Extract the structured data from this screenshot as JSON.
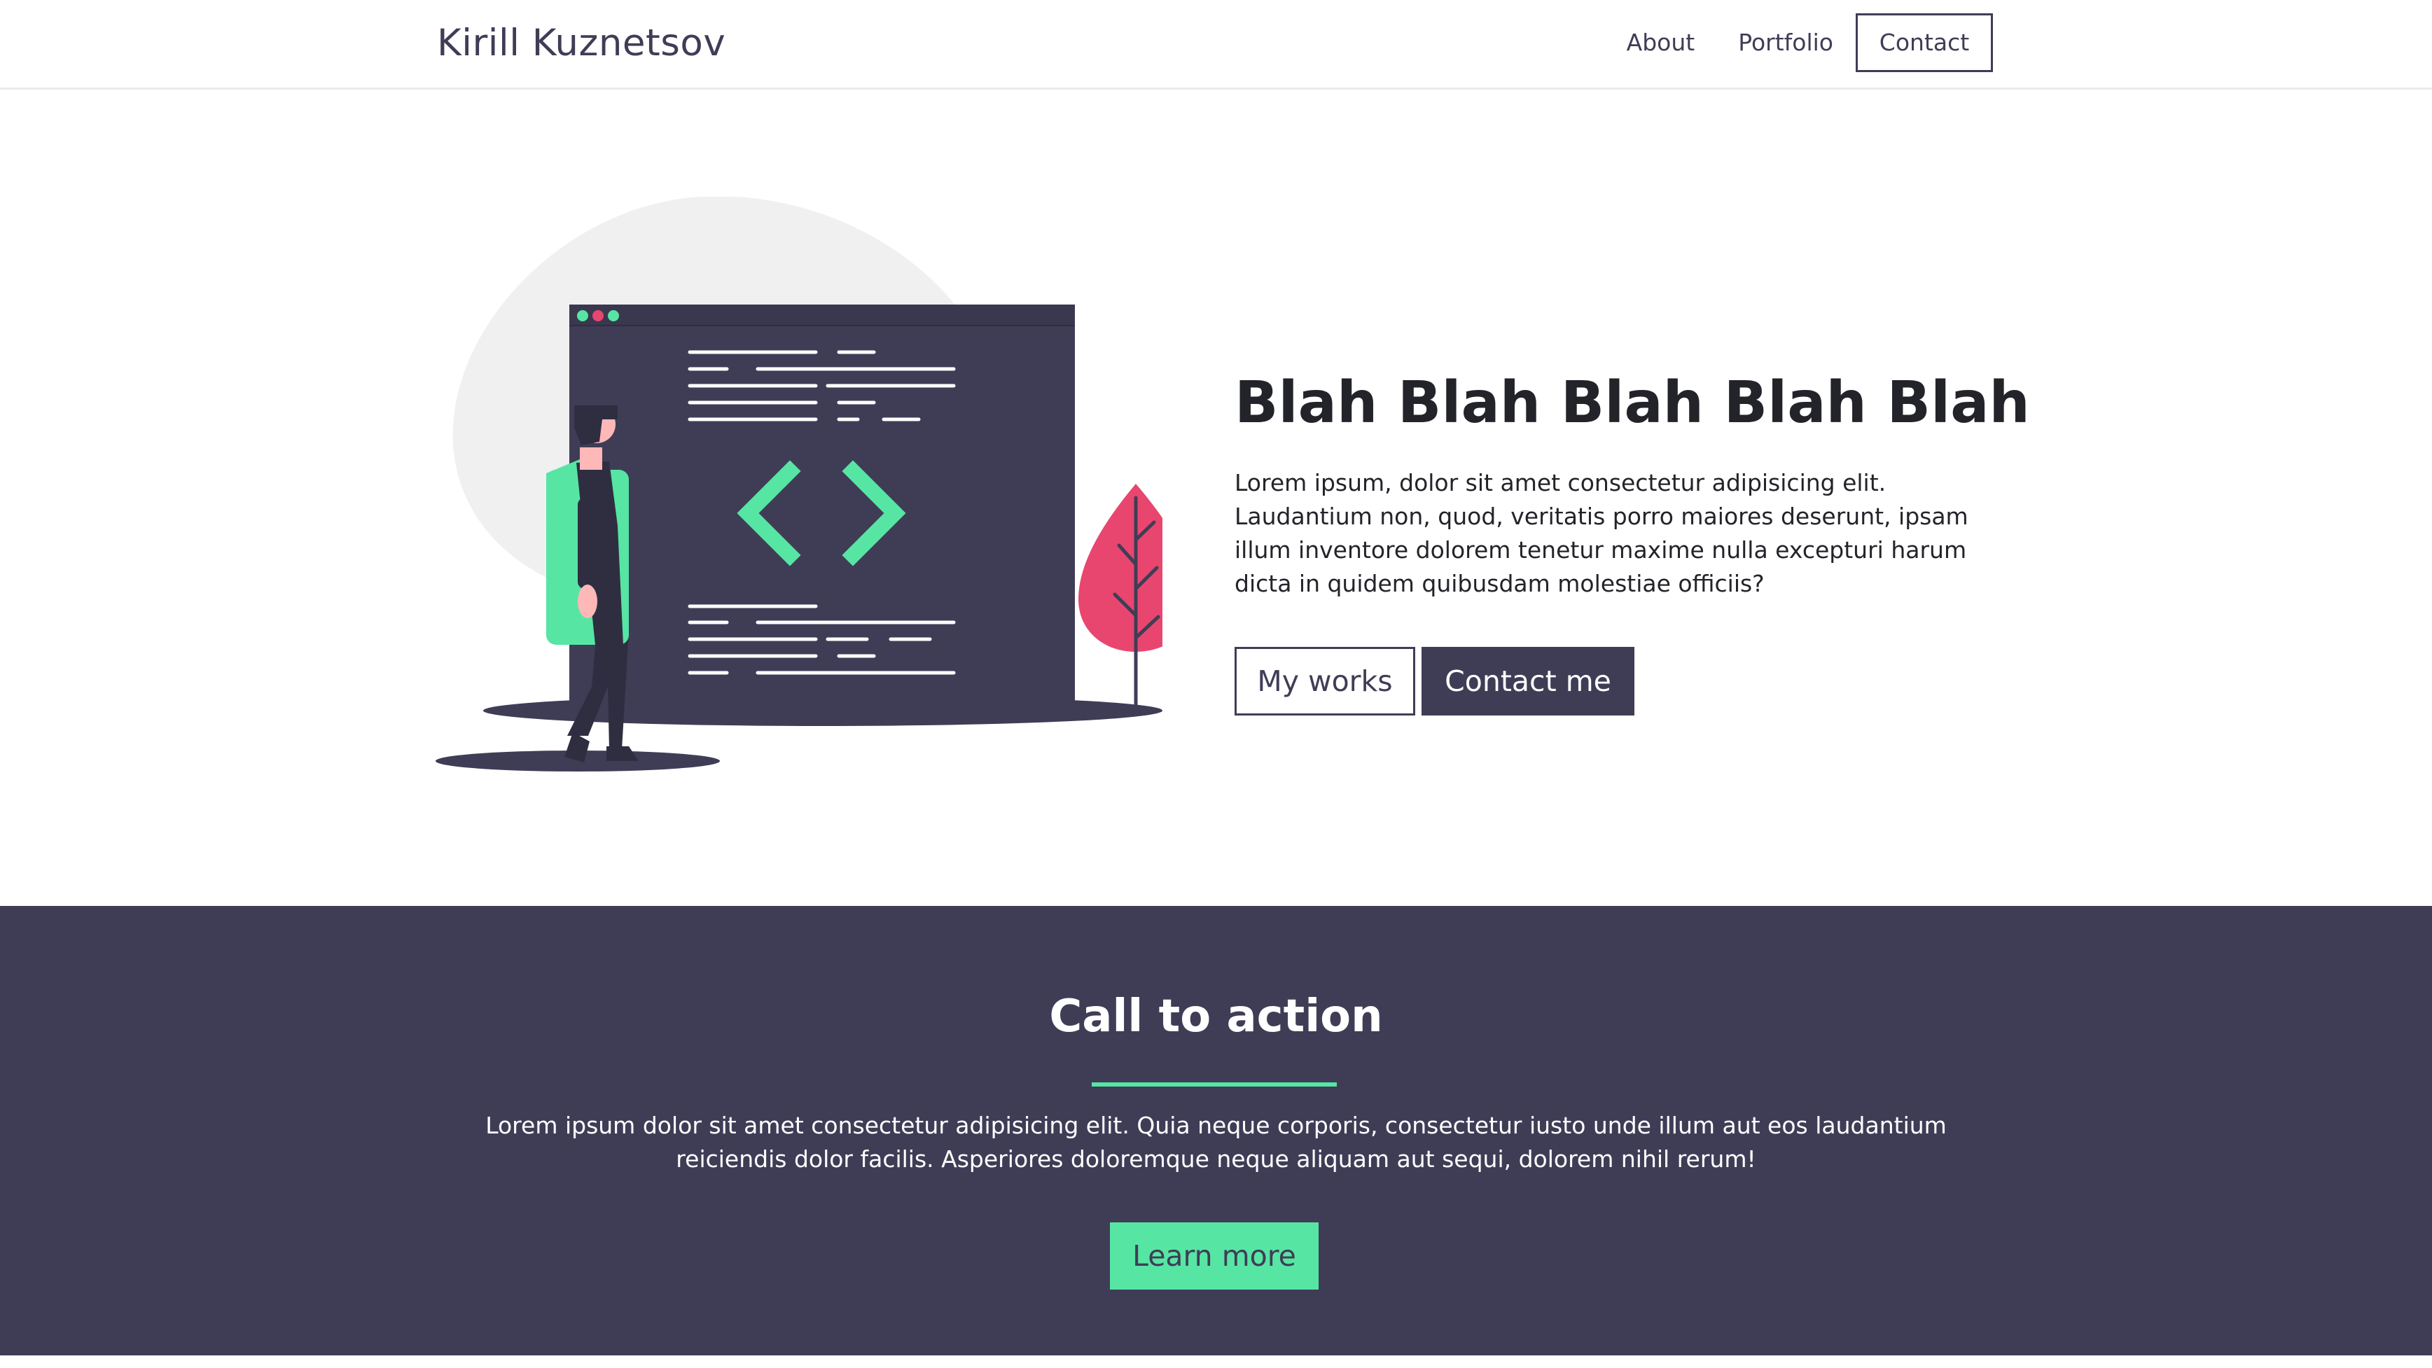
{
  "header": {
    "brand": "Kirill Kuznetsov",
    "nav": {
      "about": "About",
      "portfolio": "Portfolio",
      "contact": "Contact"
    }
  },
  "hero": {
    "title": "Blah Blah Blah Blah Blah",
    "description": "Lorem ipsum, dolor sit amet consectetur adipisicing elit. Laudantium non, quod, veritatis porro maiores deserunt, ipsam illum inventore dolorem tenetur maxime nulla excepturi harum dicta in quidem quibusdam molestiae officiis?",
    "buttons": {
      "works": "My works",
      "contact": "Contact me"
    }
  },
  "cta": {
    "title": "Call to action",
    "text": "Lorem ipsum dolor sit amet consectetur adipisicing elit. Quia neque corporis, consectetur iusto unde illum aut eos laudantium reiciendis dolor facilis. Asperiores doloremque neque aliquam aut sequi, dolorem nihil rerum!",
    "button": "Learn more"
  },
  "colors": {
    "dark": "#3f3d56",
    "accent": "#57e5a4",
    "pink": "#e8466f",
    "text": "#23232a"
  },
  "icons": [
    "code-brackets-icon"
  ]
}
